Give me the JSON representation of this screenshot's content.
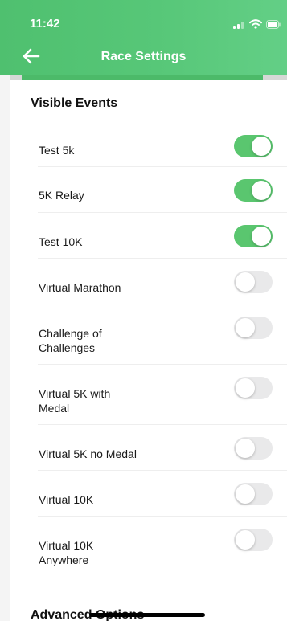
{
  "status": {
    "time": "11:42",
    "icons": [
      "signal-icon",
      "wifi-icon",
      "battery-icon"
    ]
  },
  "nav": {
    "title": "Race Settings",
    "back_icon": "back-arrow-icon"
  },
  "colors": {
    "header": "#57c778",
    "toggle_on": "#5ac66f",
    "toggle_off": "#e9e9ea"
  },
  "visible_events": {
    "title": "Visible Events",
    "items": [
      {
        "label": "Test 5k",
        "enabled": true
      },
      {
        "label": "5K Relay",
        "enabled": true
      },
      {
        "label": "Test 10K",
        "enabled": true
      },
      {
        "label": "Virtual Marathon",
        "enabled": false
      },
      {
        "label": "Challenge of\nChallenges",
        "enabled": false
      },
      {
        "label": "Virtual 5K with\nMedal",
        "enabled": false
      },
      {
        "label": "Virtual 5K no Medal",
        "enabled": false
      },
      {
        "label": "Virtual 10K",
        "enabled": false
      },
      {
        "label": "Virtual 10K\nAnywhere",
        "enabled": false
      }
    ]
  },
  "advanced": {
    "title": "Advanced Options"
  }
}
